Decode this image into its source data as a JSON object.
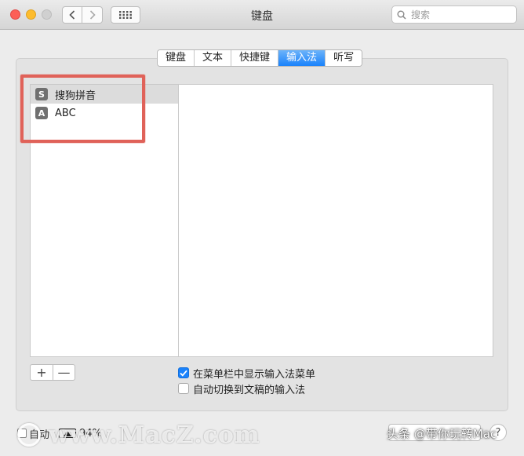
{
  "window": {
    "title": "键盘",
    "search_placeholder": "搜索"
  },
  "tabs": [
    {
      "label": "键盘",
      "active": false
    },
    {
      "label": "文本",
      "active": false
    },
    {
      "label": "快捷键",
      "active": false
    },
    {
      "label": "输入法",
      "active": true
    },
    {
      "label": "听写",
      "active": false
    }
  ],
  "input_sources": [
    {
      "icon_glyph": "S",
      "icon": "sogou-pinyin-icon",
      "label": "搜狗拼音",
      "selected": true
    },
    {
      "icon_glyph": "A",
      "icon": "abc-icon",
      "label": "ABC",
      "selected": false
    }
  ],
  "controls": {
    "add_label": "+",
    "remove_label": "—"
  },
  "options": {
    "show_in_menubar": {
      "label": "在菜单栏中显示输入法菜单",
      "checked": true
    },
    "auto_switch": {
      "label": "自动切换到文稿的输入法",
      "checked": false
    }
  },
  "bottom": {
    "left_label_fragment": "自动",
    "battery_percent": "94%",
    "help_label": "?"
  },
  "overlay": {
    "watermark_text": "www.MacZ.com",
    "credit_text": "头条 @带你玩转Mac"
  },
  "colors": {
    "accent": "#1a82fb",
    "highlight_box": "#e06259"
  }
}
